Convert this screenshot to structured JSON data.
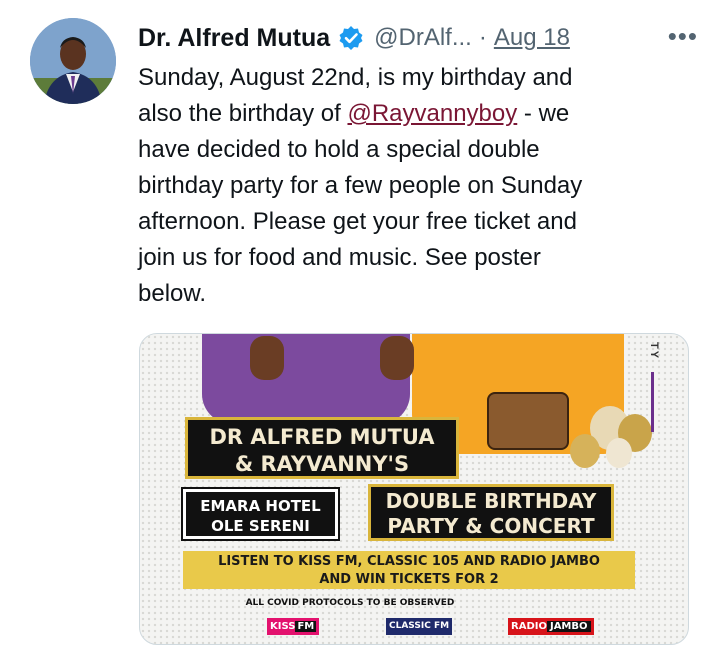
{
  "tweet": {
    "author_name": "Dr. Alfred Mutua",
    "handle": "@DrAlf...",
    "separator": "·",
    "date": "Aug 18",
    "more_label": "•••",
    "text_before_mention": "Sunday, August 22nd, is my birthday and\nalso the birthday of ",
    "mention": "@Rayvannyboy",
    "text_after_mention": " - we\nhave decided to hold a special double\nbirthday party for a few people on Sunday\nafternoon. Please get your free ticket and\njoin us for food and music. See poster\nbelow."
  },
  "poster": {
    "side_text": "TY",
    "title": "DR ALFRED MUTUA\n& RAYVANNY'S",
    "venue": "EMARA HOTEL\nOLE SERENI",
    "event": "DOUBLE BIRTHDAY\nPARTY & CONCERT",
    "promo": "LISTEN TO KISS FM, CLASSIC 105 AND RADIO JAMBO\nAND WIN TICKETS FOR 2",
    "covid": "ALL COVID PROTOCOLS TO BE OBSERVED",
    "logo_kiss_a": "KISS",
    "logo_kiss_b": "FM",
    "logo_classic": "CLASSIC FM",
    "logo_radio_a": "RADIO",
    "logo_radio_b": "JAMBO"
  },
  "colors": {
    "verified_badge": "#1d9bf0",
    "mention": "#7a1634",
    "secondary_text": "#536471",
    "poster_gold": "#e9c94a"
  }
}
